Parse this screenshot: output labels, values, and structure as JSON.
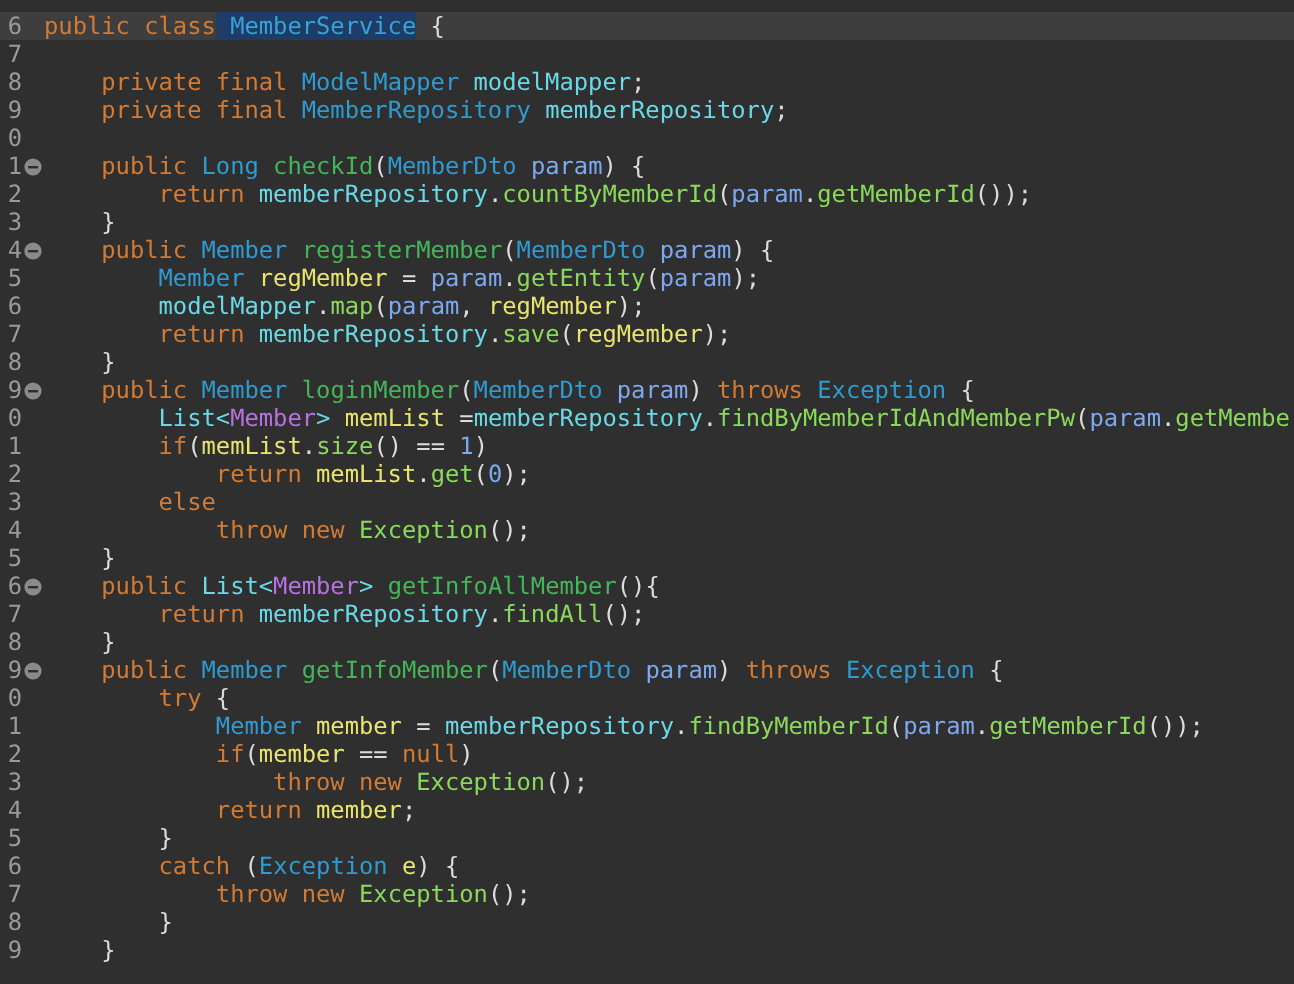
{
  "editor": {
    "lines": [
      {
        "number": "6",
        "fold": false,
        "current": true,
        "tokens": [
          {
            "text": "public class",
            "kind": "keyword"
          },
          {
            "text": " MemberService",
            "kind": "highlight"
          },
          {
            "text": " {",
            "kind": "plain"
          }
        ]
      },
      {
        "number": "7",
        "fold": false,
        "current": false
      },
      {
        "number": "8",
        "fold": false,
        "current": false,
        "tokens": [
          {
            "text": "    private final",
            "kind": "keyword"
          },
          {
            "text": " ModelMapper",
            "kind": "type"
          },
          {
            "text": " modelMapper",
            "kind": "field"
          },
          {
            "text": ";",
            "kind": "plain"
          }
        ]
      },
      {
        "number": "9",
        "fold": false,
        "current": false,
        "tokens": [
          {
            "text": "    private final",
            "kind": "keyword"
          },
          {
            "text": " MemberRepository",
            "kind": "type"
          },
          {
            "text": " memberRepository",
            "kind": "field"
          },
          {
            "text": ";",
            "kind": "plain"
          }
        ]
      },
      {
        "number": "0",
        "fold": false,
        "current": false
      },
      {
        "number": "1",
        "fold": true,
        "current": false,
        "tokens": [
          {
            "text": "    public",
            "kind": "keyword"
          },
          {
            "text": " Long",
            "kind": "type"
          },
          {
            "text": " checkId",
            "kind": "method"
          },
          {
            "text": "(",
            "kind": "plain"
          },
          {
            "text": "MemberDto",
            "kind": "type"
          },
          {
            "text": " param",
            "kind": "param"
          },
          {
            "text": ") {",
            "kind": "plain"
          }
        ]
      },
      {
        "number": "2",
        "fold": false,
        "current": false,
        "tokens": [
          {
            "text": "        return",
            "kind": "keyword"
          },
          {
            "text": " memberRepository",
            "kind": "field"
          },
          {
            "text": ".",
            "kind": "plain"
          },
          {
            "text": "countByMemberId",
            "kind": "call"
          },
          {
            "text": "(",
            "kind": "plain"
          },
          {
            "text": "param",
            "kind": "param"
          },
          {
            "text": ".",
            "kind": "plain"
          },
          {
            "text": "getMemberId",
            "kind": "call"
          },
          {
            "text": "());",
            "kind": "plain"
          }
        ]
      },
      {
        "number": "3",
        "fold": false,
        "current": false,
        "tokens": [
          {
            "text": "    }",
            "kind": "plain"
          }
        ]
      },
      {
        "number": "4",
        "fold": true,
        "current": false,
        "tokens": [
          {
            "text": "    public",
            "kind": "keyword"
          },
          {
            "text": " Member",
            "kind": "type"
          },
          {
            "text": " registerMember",
            "kind": "method"
          },
          {
            "text": "(",
            "kind": "plain"
          },
          {
            "text": "MemberDto",
            "kind": "type"
          },
          {
            "text": " param",
            "kind": "param"
          },
          {
            "text": ") {",
            "kind": "plain"
          }
        ]
      },
      {
        "number": "5",
        "fold": false,
        "current": false,
        "tokens": [
          {
            "text": "        Member",
            "kind": "type"
          },
          {
            "text": " regMember",
            "kind": "local"
          },
          {
            "text": " = ",
            "kind": "plain"
          },
          {
            "text": "param",
            "kind": "param"
          },
          {
            "text": ".",
            "kind": "plain"
          },
          {
            "text": "getEntity",
            "kind": "call"
          },
          {
            "text": "(",
            "kind": "plain"
          },
          {
            "text": "param",
            "kind": "param"
          },
          {
            "text": ");",
            "kind": "plain"
          }
        ]
      },
      {
        "number": "6",
        "fold": false,
        "current": false,
        "tokens": [
          {
            "text": "        modelMapper",
            "kind": "field"
          },
          {
            "text": ".",
            "kind": "plain"
          },
          {
            "text": "map",
            "kind": "call"
          },
          {
            "text": "(",
            "kind": "plain"
          },
          {
            "text": "param",
            "kind": "param"
          },
          {
            "text": ",",
            "kind": "plain"
          },
          {
            "text": " regMember",
            "kind": "local"
          },
          {
            "text": ");",
            "kind": "plain"
          }
        ]
      },
      {
        "number": "7",
        "fold": false,
        "current": false,
        "tokens": [
          {
            "text": "        return",
            "kind": "keyword"
          },
          {
            "text": " memberRepository",
            "kind": "field"
          },
          {
            "text": ".",
            "kind": "plain"
          },
          {
            "text": "save",
            "kind": "call"
          },
          {
            "text": "(",
            "kind": "plain"
          },
          {
            "text": "regMember",
            "kind": "local"
          },
          {
            "text": ");",
            "kind": "plain"
          }
        ]
      },
      {
        "number": "8",
        "fold": false,
        "current": false,
        "tokens": [
          {
            "text": "    }",
            "kind": "plain"
          }
        ]
      },
      {
        "number": "9",
        "fold": true,
        "current": false,
        "tokens": [
          {
            "text": "    public",
            "kind": "keyword"
          },
          {
            "text": " Member",
            "kind": "type"
          },
          {
            "text": " loginMember",
            "kind": "method"
          },
          {
            "text": "(",
            "kind": "plain"
          },
          {
            "text": "MemberDto",
            "kind": "type"
          },
          {
            "text": " param",
            "kind": "param"
          },
          {
            "text": ")",
            "kind": "plain"
          },
          {
            "text": " throws",
            "kind": "keyword"
          },
          {
            "text": " Exception",
            "kind": "type"
          },
          {
            "text": " {",
            "kind": "plain"
          }
        ]
      },
      {
        "number": "0",
        "fold": false,
        "current": false,
        "tokens": [
          {
            "text": "        List<",
            "kind": "field"
          },
          {
            "text": "Member",
            "kind": "generic"
          },
          {
            "text": ">",
            "kind": "field"
          },
          {
            "text": " memList",
            "kind": "local"
          },
          {
            "text": " =",
            "kind": "plain"
          },
          {
            "text": "memberRepository",
            "kind": "field"
          },
          {
            "text": ".",
            "kind": "plain"
          },
          {
            "text": "findByMemberIdAndMemberPw",
            "kind": "call"
          },
          {
            "text": "(",
            "kind": "plain"
          },
          {
            "text": "param",
            "kind": "param"
          },
          {
            "text": ".",
            "kind": "plain"
          },
          {
            "text": "getMembe",
            "kind": "call"
          }
        ]
      },
      {
        "number": "1",
        "fold": false,
        "current": false,
        "tokens": [
          {
            "text": "        if",
            "kind": "keyword"
          },
          {
            "text": "(",
            "kind": "plain"
          },
          {
            "text": "memList",
            "kind": "local"
          },
          {
            "text": ".",
            "kind": "plain"
          },
          {
            "text": "size",
            "kind": "call"
          },
          {
            "text": "() == ",
            "kind": "plain"
          },
          {
            "text": "1",
            "kind": "number"
          },
          {
            "text": ")",
            "kind": "plain"
          }
        ]
      },
      {
        "number": "2",
        "fold": false,
        "current": false,
        "tokens": [
          {
            "text": "            return",
            "kind": "keyword"
          },
          {
            "text": " memList",
            "kind": "local"
          },
          {
            "text": ".",
            "kind": "plain"
          },
          {
            "text": "get",
            "kind": "call"
          },
          {
            "text": "(",
            "kind": "plain"
          },
          {
            "text": "0",
            "kind": "number"
          },
          {
            "text": ");",
            "kind": "plain"
          }
        ]
      },
      {
        "number": "3",
        "fold": false,
        "current": false,
        "tokens": [
          {
            "text": "        else",
            "kind": "keyword"
          }
        ]
      },
      {
        "number": "4",
        "fold": false,
        "current": false,
        "tokens": [
          {
            "text": "            throw new",
            "kind": "keyword"
          },
          {
            "text": " Exception",
            "kind": "call"
          },
          {
            "text": "();",
            "kind": "plain"
          }
        ]
      },
      {
        "number": "5",
        "fold": false,
        "current": false,
        "tokens": [
          {
            "text": "    }",
            "kind": "plain"
          }
        ]
      },
      {
        "number": "6",
        "fold": true,
        "current": false,
        "tokens": [
          {
            "text": "    public",
            "kind": "keyword"
          },
          {
            "text": " List<",
            "kind": "field"
          },
          {
            "text": "Member",
            "kind": "generic"
          },
          {
            "text": ">",
            "kind": "field"
          },
          {
            "text": " getInfoAllMember",
            "kind": "method"
          },
          {
            "text": "(){",
            "kind": "plain"
          }
        ]
      },
      {
        "number": "7",
        "fold": false,
        "current": false,
        "tokens": [
          {
            "text": "        return",
            "kind": "keyword"
          },
          {
            "text": " memberRepository",
            "kind": "field"
          },
          {
            "text": ".",
            "kind": "plain"
          },
          {
            "text": "findAll",
            "kind": "call"
          },
          {
            "text": "();",
            "kind": "plain"
          }
        ]
      },
      {
        "number": "8",
        "fold": false,
        "current": false,
        "tokens": [
          {
            "text": "    }",
            "kind": "plain"
          }
        ]
      },
      {
        "number": "9",
        "fold": true,
        "current": false,
        "tokens": [
          {
            "text": "    public",
            "kind": "keyword"
          },
          {
            "text": " Member",
            "kind": "type"
          },
          {
            "text": " getInfoMember",
            "kind": "method"
          },
          {
            "text": "(",
            "kind": "plain"
          },
          {
            "text": "MemberDto",
            "kind": "type"
          },
          {
            "text": " param",
            "kind": "param"
          },
          {
            "text": ")",
            "kind": "plain"
          },
          {
            "text": " throws",
            "kind": "keyword"
          },
          {
            "text": " Exception",
            "kind": "type"
          },
          {
            "text": " {",
            "kind": "plain"
          }
        ]
      },
      {
        "number": "0",
        "fold": false,
        "current": false,
        "tokens": [
          {
            "text": "        try",
            "kind": "keyword"
          },
          {
            "text": " {",
            "kind": "plain"
          }
        ]
      },
      {
        "number": "1",
        "fold": false,
        "current": false,
        "tokens": [
          {
            "text": "            Member",
            "kind": "type"
          },
          {
            "text": " member",
            "kind": "local"
          },
          {
            "text": " = ",
            "kind": "plain"
          },
          {
            "text": "memberRepository",
            "kind": "field"
          },
          {
            "text": ".",
            "kind": "plain"
          },
          {
            "text": "findByMemberId",
            "kind": "call"
          },
          {
            "text": "(",
            "kind": "plain"
          },
          {
            "text": "param",
            "kind": "param"
          },
          {
            "text": ".",
            "kind": "plain"
          },
          {
            "text": "getMemberId",
            "kind": "call"
          },
          {
            "text": "());",
            "kind": "plain"
          }
        ]
      },
      {
        "number": "2",
        "fold": false,
        "current": false,
        "tokens": [
          {
            "text": "            if",
            "kind": "keyword"
          },
          {
            "text": "(",
            "kind": "plain"
          },
          {
            "text": "member",
            "kind": "local"
          },
          {
            "text": " == ",
            "kind": "plain"
          },
          {
            "text": "null",
            "kind": "keyword"
          },
          {
            "text": ")",
            "kind": "plain"
          }
        ]
      },
      {
        "number": "3",
        "fold": false,
        "current": false,
        "tokens": [
          {
            "text": "                throw new",
            "kind": "keyword"
          },
          {
            "text": " Exception",
            "kind": "call"
          },
          {
            "text": "();",
            "kind": "plain"
          }
        ]
      },
      {
        "number": "4",
        "fold": false,
        "current": false,
        "tokens": [
          {
            "text": "            return",
            "kind": "keyword"
          },
          {
            "text": " member",
            "kind": "local"
          },
          {
            "text": ";",
            "kind": "plain"
          }
        ]
      },
      {
        "number": "5",
        "fold": false,
        "current": false,
        "tokens": [
          {
            "text": "        }",
            "kind": "plain"
          }
        ]
      },
      {
        "number": "6",
        "fold": false,
        "current": false,
        "tokens": [
          {
            "text": "        catch",
            "kind": "keyword"
          },
          {
            "text": " (",
            "kind": "plain"
          },
          {
            "text": "Exception",
            "kind": "type"
          },
          {
            "text": " e",
            "kind": "local"
          },
          {
            "text": ") {",
            "kind": "plain"
          }
        ]
      },
      {
        "number": "7",
        "fold": false,
        "current": false,
        "tokens": [
          {
            "text": "            throw new",
            "kind": "keyword"
          },
          {
            "text": " Exception",
            "kind": "call"
          },
          {
            "text": "();",
            "kind": "plain"
          }
        ]
      },
      {
        "number": "8",
        "fold": false,
        "current": false,
        "tokens": [
          {
            "text": "        }",
            "kind": "plain"
          }
        ]
      },
      {
        "number": "9",
        "fold": false,
        "current": false,
        "tokens": [
          {
            "text": "    }",
            "kind": "plain"
          }
        ]
      }
    ]
  }
}
